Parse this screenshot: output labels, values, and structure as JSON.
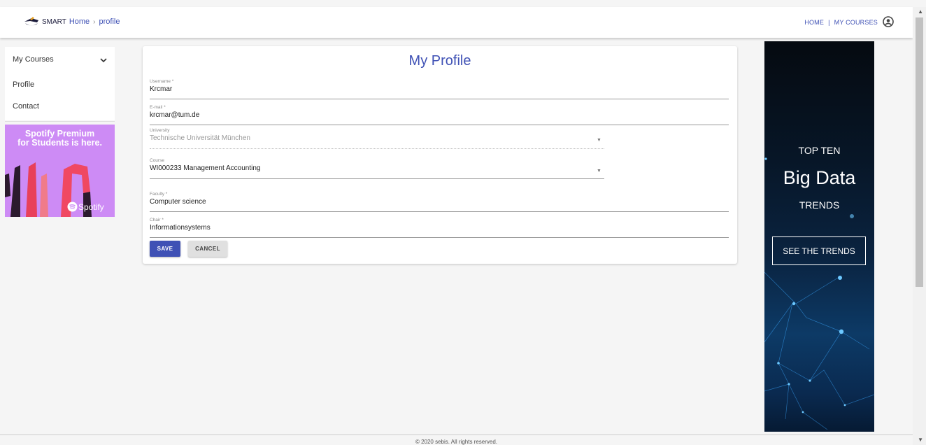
{
  "header": {
    "brand": "SMART",
    "breadcrumb": [
      "Home",
      "profile"
    ],
    "nav": [
      "HOME",
      "MY COURSES"
    ],
    "separator": "|"
  },
  "sidebar": {
    "items": [
      {
        "label": "My Courses"
      },
      {
        "label": "Profile"
      },
      {
        "label": "Contact"
      }
    ]
  },
  "spotify_ad": {
    "headline_line1": "Spotify Premium",
    "headline_line2": "for Students is here.",
    "logo_text": "Spotify"
  },
  "profile": {
    "title": "My Profile",
    "fields": {
      "username": {
        "label": "Username *",
        "value": "Krcmar"
      },
      "email": {
        "label": "E-mail *",
        "value": "krcmar@tum.de"
      },
      "university": {
        "label": "University",
        "value": "Technische Universität München"
      },
      "course": {
        "label": "Course",
        "value": "WI000233 Management Accounting"
      },
      "faculty": {
        "label": "Faculty *",
        "value": "Computer science"
      },
      "chair": {
        "label": "Chair *",
        "value": "Informationsystems"
      }
    },
    "save_label": "SAVE",
    "cancel_label": "CANCEL"
  },
  "bigdata_ad": {
    "top": "TOP TEN",
    "main": "Big Data",
    "trends": "TRENDS",
    "cta": "SEE THE TRENDS"
  },
  "footer": {
    "text": "© 2020 sebis. All rights reserved."
  },
  "colors": {
    "primary": "#3f51b5",
    "spotify_bg": "#cd8bf5"
  }
}
